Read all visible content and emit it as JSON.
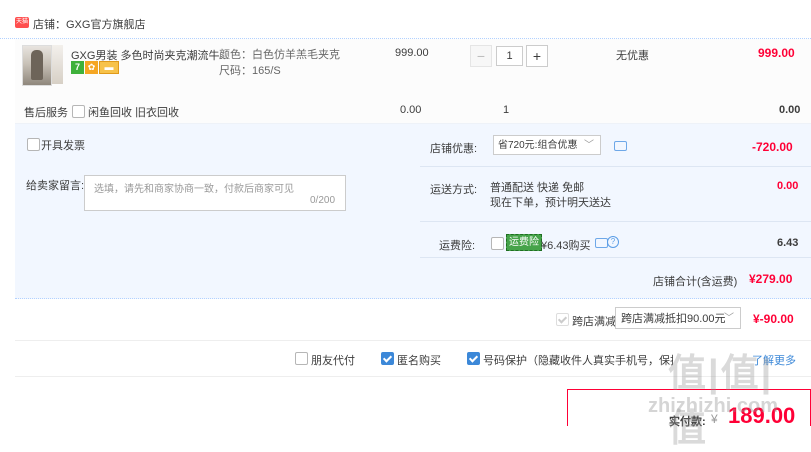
{
  "shop": {
    "badge": "天猫",
    "name": "店铺：GXG官方旗舰店"
  },
  "item": {
    "title": "GXG男装 多色时尚夹克潮流牛...",
    "icon_seven": "7",
    "color": "颜色：白色仿羊羔毛夹克",
    "size": "尺码：165/S",
    "price": "999.00",
    "quantity": "1",
    "discount": "无优惠",
    "total": "999.00"
  },
  "service": {
    "label": "售后服务",
    "option": "闲鱼回收 旧衣回收",
    "value": "0.00",
    "quantity": "1",
    "total": "0.00"
  },
  "order": {
    "invoice_label": "开具发票",
    "message_label": "给卖家留言:",
    "message_placeholder": "选填，请先和商家协商一致，付款后商家可见",
    "message_count": "0/200",
    "shop_discount_label": "店铺优惠:",
    "shop_discount_selected": "省720元:组合优惠",
    "shop_discount_amount": "-720.00",
    "shipping_label": "运送方式:",
    "shipping_line1": "普通配送 快递 免邮",
    "shipping_line2": "现在下单，预计明天送达",
    "shipping_amount": "0.00",
    "insurance_label": "运费险:",
    "insurance_tag": "运费险",
    "insurance_price": "¥6.43购买",
    "insurance_amount": "6.43",
    "shop_total_label": "店铺合计(含运费)",
    "shop_total": "¥279.00"
  },
  "cross_store": {
    "label": "跨店满减",
    "selected": "跨店满减抵扣90.00元",
    "amount": "¥-90.00"
  },
  "options": {
    "friend_pay": "朋友代付",
    "anonymous": "匿名购买",
    "privacy": "号码保护（隐藏收件人真实手机号，保护隐私）",
    "privacy_more": "了解更多"
  },
  "payment": {
    "label": "实付款:",
    "currency": "¥",
    "amount": "189.00"
  },
  "watermark": {
    "text": "值|值|值",
    "url": "zhizhizhi.com"
  },
  "colors": {
    "accent": "#ff0036",
    "info_bg": "#f2f7ff",
    "link": "#3c88d8"
  }
}
